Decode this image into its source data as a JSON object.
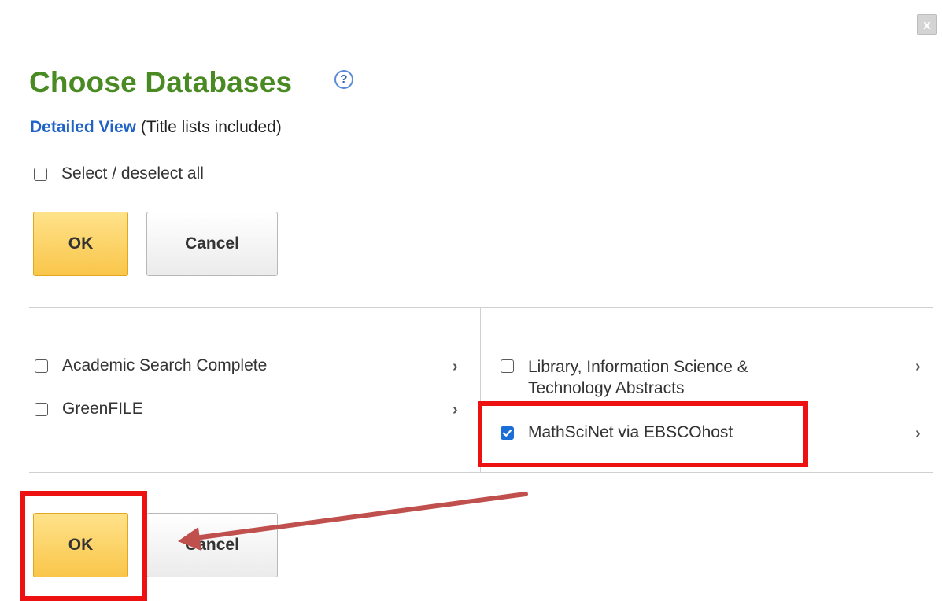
{
  "dialog": {
    "close_label": "x",
    "title": "Choose Databases",
    "help_icon": "question-circle-icon",
    "detailed_view_link": "Detailed View",
    "detailed_view_note": "(Title lists included)",
    "select_all_label": "Select / deselect all"
  },
  "buttons": {
    "ok_label": "OK",
    "cancel_label": "Cancel"
  },
  "databases": {
    "left": [
      {
        "label": "Academic Search Complete",
        "checked": false
      },
      {
        "label": "GreenFILE",
        "checked": false
      }
    ],
    "right": [
      {
        "label": "Library, Information Science & Technology Abstracts",
        "checked": false
      },
      {
        "label": "MathSciNet via EBSCOhost",
        "checked": true
      }
    ],
    "chevron_icon": "chevron-right-icon"
  },
  "colors": {
    "title": "#4a8a22",
    "link": "#1f63c6",
    "ok_button": "#f9c64a",
    "highlight": "#ee1111",
    "arrow": "#c0504d",
    "checkbox_checked": "#1a6ed8"
  }
}
